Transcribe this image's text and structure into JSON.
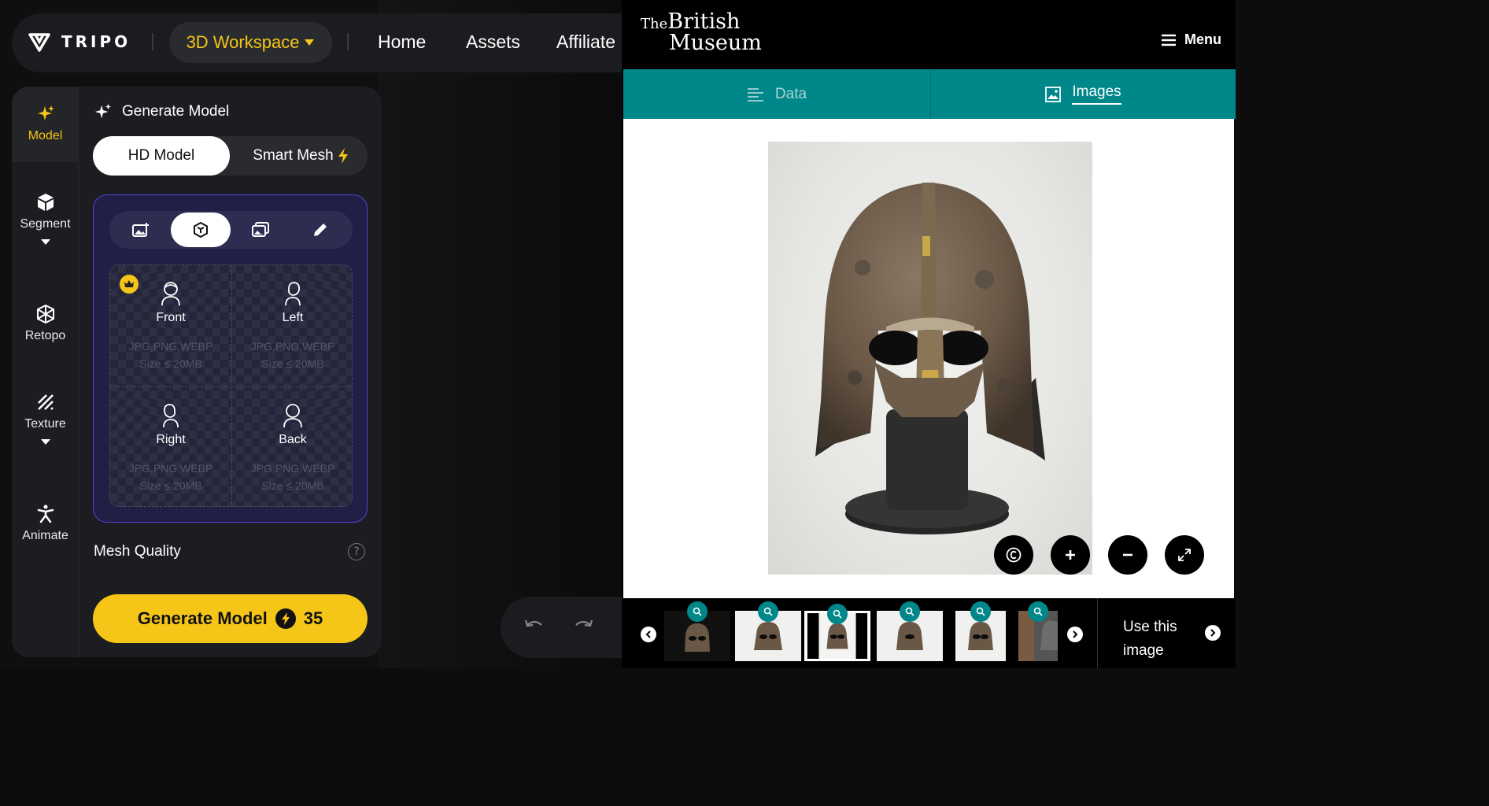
{
  "tripo": {
    "brand": "TRIPO",
    "workspace_label": "3D Workspace",
    "nav": [
      "Home",
      "Assets",
      "Affiliate"
    ],
    "sidebar": [
      {
        "label": "Model",
        "icon": "sparkles-icon",
        "active": true
      },
      {
        "label": "Segment",
        "icon": "cube-icon",
        "dropdown": true
      },
      {
        "label": "Retopo",
        "icon": "mesh-icon"
      },
      {
        "label": "Texture",
        "icon": "texture-icon",
        "dropdown": true
      },
      {
        "label": "Animate",
        "icon": "figure-icon"
      }
    ],
    "panel_title": "Generate Model",
    "mode_hd": "HD Model",
    "mode_smart": "Smart Mesh",
    "upload_tabs": [
      "image-upload-icon",
      "cube-view-icon",
      "multi-image-icon",
      "pencil-icon"
    ],
    "views": [
      {
        "name": "Front",
        "formats": "JPG,PNG,WEBP",
        "size": "Size ≤ 20MB"
      },
      {
        "name": "Left",
        "formats": "JPG,PNG,WEBP",
        "size": "Size ≤ 20MB"
      },
      {
        "name": "Right",
        "formats": "JPG,PNG,WEBP",
        "size": "Size ≤ 20MB"
      },
      {
        "name": "Back",
        "formats": "JPG,PNG,WEBP",
        "size": "Size ≤ 20MB"
      }
    ],
    "mesh_quality": "Mesh Quality",
    "help_glyph": "?",
    "generate_label": "Generate Model",
    "generate_cost": "35",
    "accent": "#f5c518"
  },
  "museum": {
    "logo_the": "The",
    "logo_british": "British",
    "logo_museum": "Museum",
    "menu_label": "Menu",
    "tab_data": "Data",
    "tab_images": "Images",
    "use_image_line1": "Use this",
    "use_image_line2": "image",
    "teal": "#00878a"
  }
}
